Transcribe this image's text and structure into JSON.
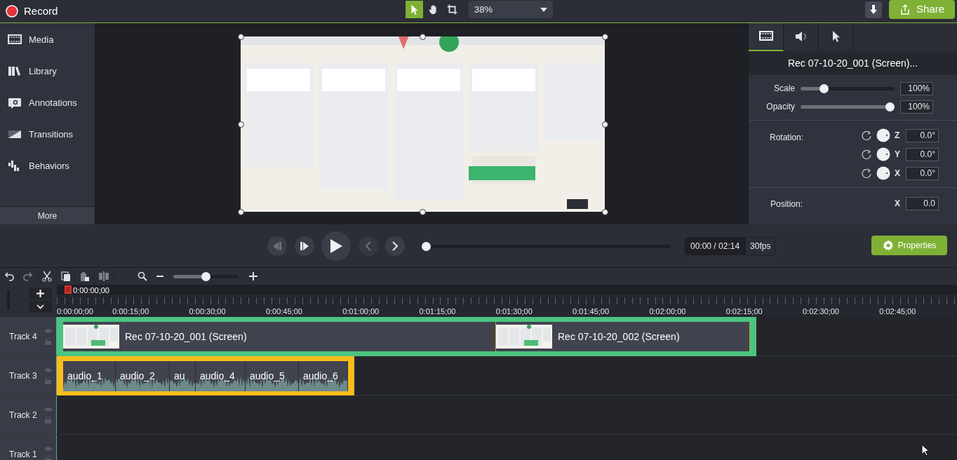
{
  "title_bar": {
    "record": "Record",
    "tools": [
      {
        "kind": "pointer",
        "selected": true
      },
      {
        "kind": "hand",
        "selected": false
      },
      {
        "kind": "crop",
        "selected": false
      }
    ],
    "zoom": "38%",
    "share": "Share"
  },
  "sidebar": {
    "items": [
      {
        "kind": "media",
        "label": "Media"
      },
      {
        "kind": "library",
        "label": "Library"
      },
      {
        "kind": "annotations",
        "label": "Annotations"
      },
      {
        "kind": "transitions",
        "label": "Transitions"
      },
      {
        "kind": "behaviors",
        "label": "Behaviors"
      }
    ],
    "more": "More"
  },
  "properties_panel": {
    "tabs": [
      {
        "kind": "visual",
        "selected": true
      },
      {
        "kind": "audio",
        "selected": false
      },
      {
        "kind": "cursor",
        "selected": false
      }
    ],
    "clip_title": "Rec 07-10-20_001 (Screen)...",
    "sliders": [
      {
        "label": "Scale",
        "level": 0.22,
        "value": "100%"
      },
      {
        "label": "Opacity",
        "level": 1,
        "value": "100%"
      }
    ],
    "rotation": {
      "label": "Rotation:",
      "axes": [
        {
          "axis": "Z",
          "value": "0.0°"
        },
        {
          "axis": "Y",
          "value": "0.0°"
        },
        {
          "axis": "X",
          "value": "0.0°"
        }
      ]
    },
    "position": {
      "label": "Position:",
      "axes": [
        {
          "axis": "X",
          "value": "0.0"
        }
      ]
    }
  },
  "playback": {
    "scrubber": {
      "level": 0
    },
    "time": "00:00 / 02:14",
    "fps": "30fps",
    "properties_button": "Properties"
  },
  "timeline": {
    "zoom_slider": {
      "level": 0.5
    },
    "playhead_time": "0:00:00;00",
    "ruler_labels": [
      "0:00:00;00",
      "0:00:15;00",
      "0:00:30;00",
      "0:00:45;00",
      "0:01:00;00",
      "0:01:15;00",
      "0:01:30;00",
      "0:01:45;00",
      "0:02:00;00",
      "0:02:15;00",
      "0:02:30;00",
      "0:02:45;00"
    ],
    "tracks": [
      {
        "name": "Track 4",
        "groups": [
          {
            "color": "#4cc47f",
            "clips": [
              {
                "kind": "video",
                "label": "Rec 07-10-20_001 (Screen)"
              },
              {
                "kind": "video",
                "label": "Rec 07-10-20_002 (Screen)"
              }
            ]
          }
        ]
      },
      {
        "name": "Track 3",
        "groups": [
          {
            "color": "#f8bd1c",
            "clips": [
              {
                "kind": "audio",
                "label": "audio_1"
              },
              {
                "kind": "audio",
                "label": "audio_2"
              },
              {
                "kind": "audio",
                "label": "au"
              },
              {
                "kind": "audio",
                "label": "audio_4"
              },
              {
                "kind": "audio",
                "label": "audio_5"
              },
              {
                "kind": "audio",
                "label": "audio_6"
              }
            ]
          }
        ]
      },
      {
        "name": "Track 2"
      },
      {
        "name": "Track 1"
      }
    ]
  }
}
